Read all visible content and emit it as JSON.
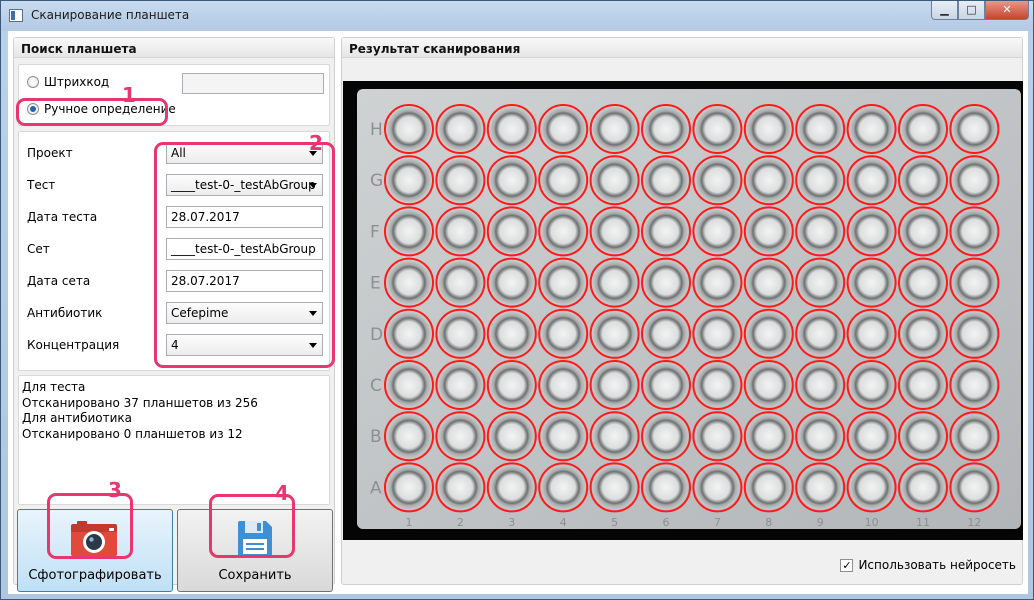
{
  "window": {
    "title": "Сканирование планшета",
    "buttons": {
      "minimize": "▁",
      "maximize": "□",
      "close": "✕"
    }
  },
  "left": {
    "header": "Поиск планшета",
    "barcode_option": "Штрихкод",
    "barcode_value": "",
    "manual_option": "Ручное определение",
    "selected_option": "manual",
    "fields": [
      {
        "label": "Проект",
        "value": "All",
        "type": "combo"
      },
      {
        "label": "Тест",
        "value": "____test-0-_testAbGroup",
        "type": "combo"
      },
      {
        "label": "Дата теста",
        "value": "28.07.2017",
        "type": "text"
      },
      {
        "label": "Сет",
        "value": "____test-0-_testAbGroup",
        "type": "text"
      },
      {
        "label": "Дата сета",
        "value": "28.07.2017",
        "type": "text"
      },
      {
        "label": "Антибиотик",
        "value": "Cefepime",
        "type": "combo"
      },
      {
        "label": "Концентрация",
        "value": "4",
        "type": "combo"
      }
    ],
    "status_lines": [
      "Для теста",
      "Отсканировано 37 планшетов из 256",
      "Для антибиотика",
      "Отсканировано 0 планшетов из 12"
    ]
  },
  "buttons": {
    "photo_label": "Сфотографировать",
    "save_label": "Сохранить"
  },
  "right": {
    "header": "Результат сканирования",
    "neural_checkbox_label": "Использовать нейросеть",
    "neural_checked": true,
    "plate": {
      "rows": [
        "H",
        "G",
        "F",
        "E",
        "D",
        "C",
        "B",
        "A"
      ],
      "columns": [
        "1",
        "2",
        "3",
        "4",
        "5",
        "6",
        "7",
        "8",
        "9",
        "10",
        "11",
        "12"
      ]
    }
  },
  "callouts": [
    "1",
    "2",
    "3",
    "4"
  ],
  "colors": {
    "accent": "#e8366f",
    "well_ring": "#ff1a1a",
    "photo_icon": "#e04a3c",
    "save_icon": "#3d8fd6"
  }
}
